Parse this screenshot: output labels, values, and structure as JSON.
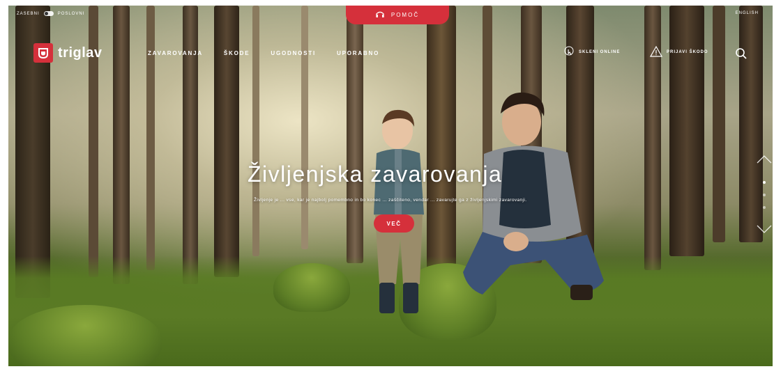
{
  "top_bar": {
    "segment_left": "ZASEBNI",
    "segment_right": "POSLOVNI",
    "language": "ENGLISH"
  },
  "help": {
    "label": "POMOČ",
    "icon": "support-icon"
  },
  "logo": {
    "text": "triglav"
  },
  "nav": {
    "items": [
      {
        "label": "ZAVAROVANJA"
      },
      {
        "label": "ŠKODE"
      },
      {
        "label": "UGODNOSTI"
      },
      {
        "label": "UPORABNO"
      }
    ]
  },
  "utility": {
    "online": {
      "label": "SKLENI ONLINE",
      "icon": "pointer-hand-icon"
    },
    "emergency": {
      "label": "PRIJAVI ŠKODO",
      "icon": "warning-triangle-icon"
    },
    "search_icon": "search-icon"
  },
  "hero": {
    "title": "Življenjska zavarovanja",
    "subtitle": "Življenje je ... vse, kar je najbolj pomembno in bo konec ... zaščiteno, vendar ... zavarujte ga z življenjskimi zavarovanji.",
    "button": "VEČ"
  },
  "slider": {
    "total": 3,
    "active_index": 0
  },
  "colors": {
    "brand_red": "#d5303b"
  }
}
